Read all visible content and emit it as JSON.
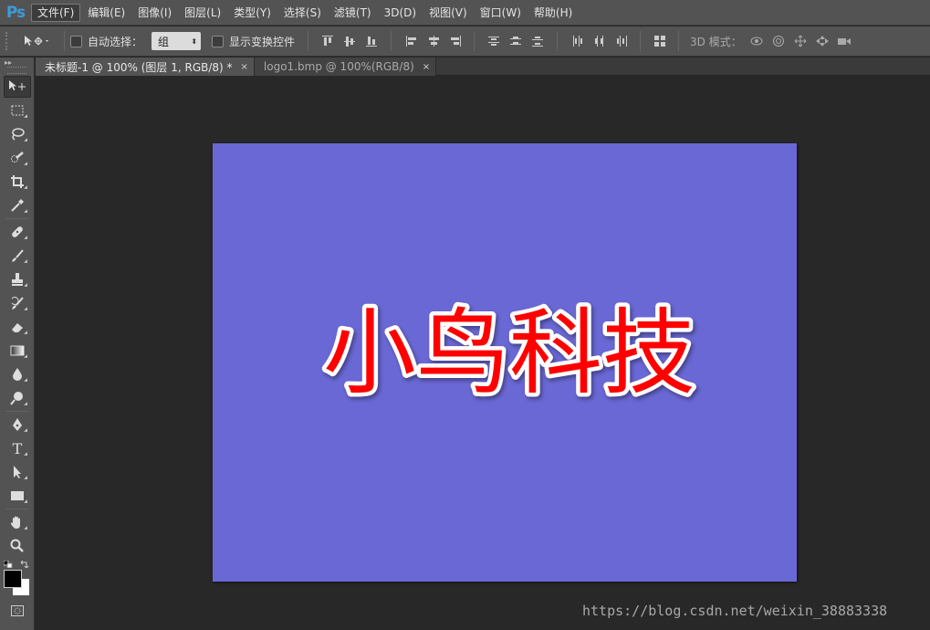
{
  "app": {
    "logo": "Ps"
  },
  "menu": [
    {
      "label": "文件(F)",
      "active": true
    },
    {
      "label": "编辑(E)"
    },
    {
      "label": "图像(I)"
    },
    {
      "label": "图层(L)"
    },
    {
      "label": "类型(Y)"
    },
    {
      "label": "选择(S)"
    },
    {
      "label": "滤镜(T)"
    },
    {
      "label": "3D(D)"
    },
    {
      "label": "视图(V)"
    },
    {
      "label": "窗口(W)"
    },
    {
      "label": "帮助(H)"
    }
  ],
  "options": {
    "auto_select_label": "自动选择：",
    "auto_select_value": "组",
    "show_transform_label": "显示变换控件",
    "mode3d_label": "3D 模式："
  },
  "tabs": [
    {
      "label": "未标题-1 @ 100% (图层 1, RGB/8) *",
      "close": "×",
      "active": true
    },
    {
      "label": "logo1.bmp @ 100%(RGB/8)",
      "close": "×",
      "active": false
    }
  ],
  "canvas": {
    "text": "小鸟科技",
    "background_color": "#6a68d4",
    "text_color": "#ff0000",
    "stroke_color": "#ffffff"
  },
  "tools": [
    "move-tool-icon",
    "marquee-tool-icon",
    "lasso-tool-icon",
    "quick-select-tool-icon",
    "crop-tool-icon",
    "eyedropper-tool-icon",
    "healing-brush-tool-icon",
    "brush-tool-icon",
    "clone-stamp-tool-icon",
    "history-brush-tool-icon",
    "eraser-tool-icon",
    "gradient-tool-icon",
    "blur-tool-icon",
    "dodge-tool-icon",
    "pen-tool-icon",
    "type-tool-icon",
    "path-select-tool-icon",
    "rectangle-tool-icon",
    "hand-tool-icon",
    "zoom-tool-icon"
  ],
  "type_tool_glyph": "T",
  "colors": {
    "foreground": "#000000",
    "background": "#ffffff"
  },
  "watermark": "https://blog.csdn.net/weixin_38883338"
}
